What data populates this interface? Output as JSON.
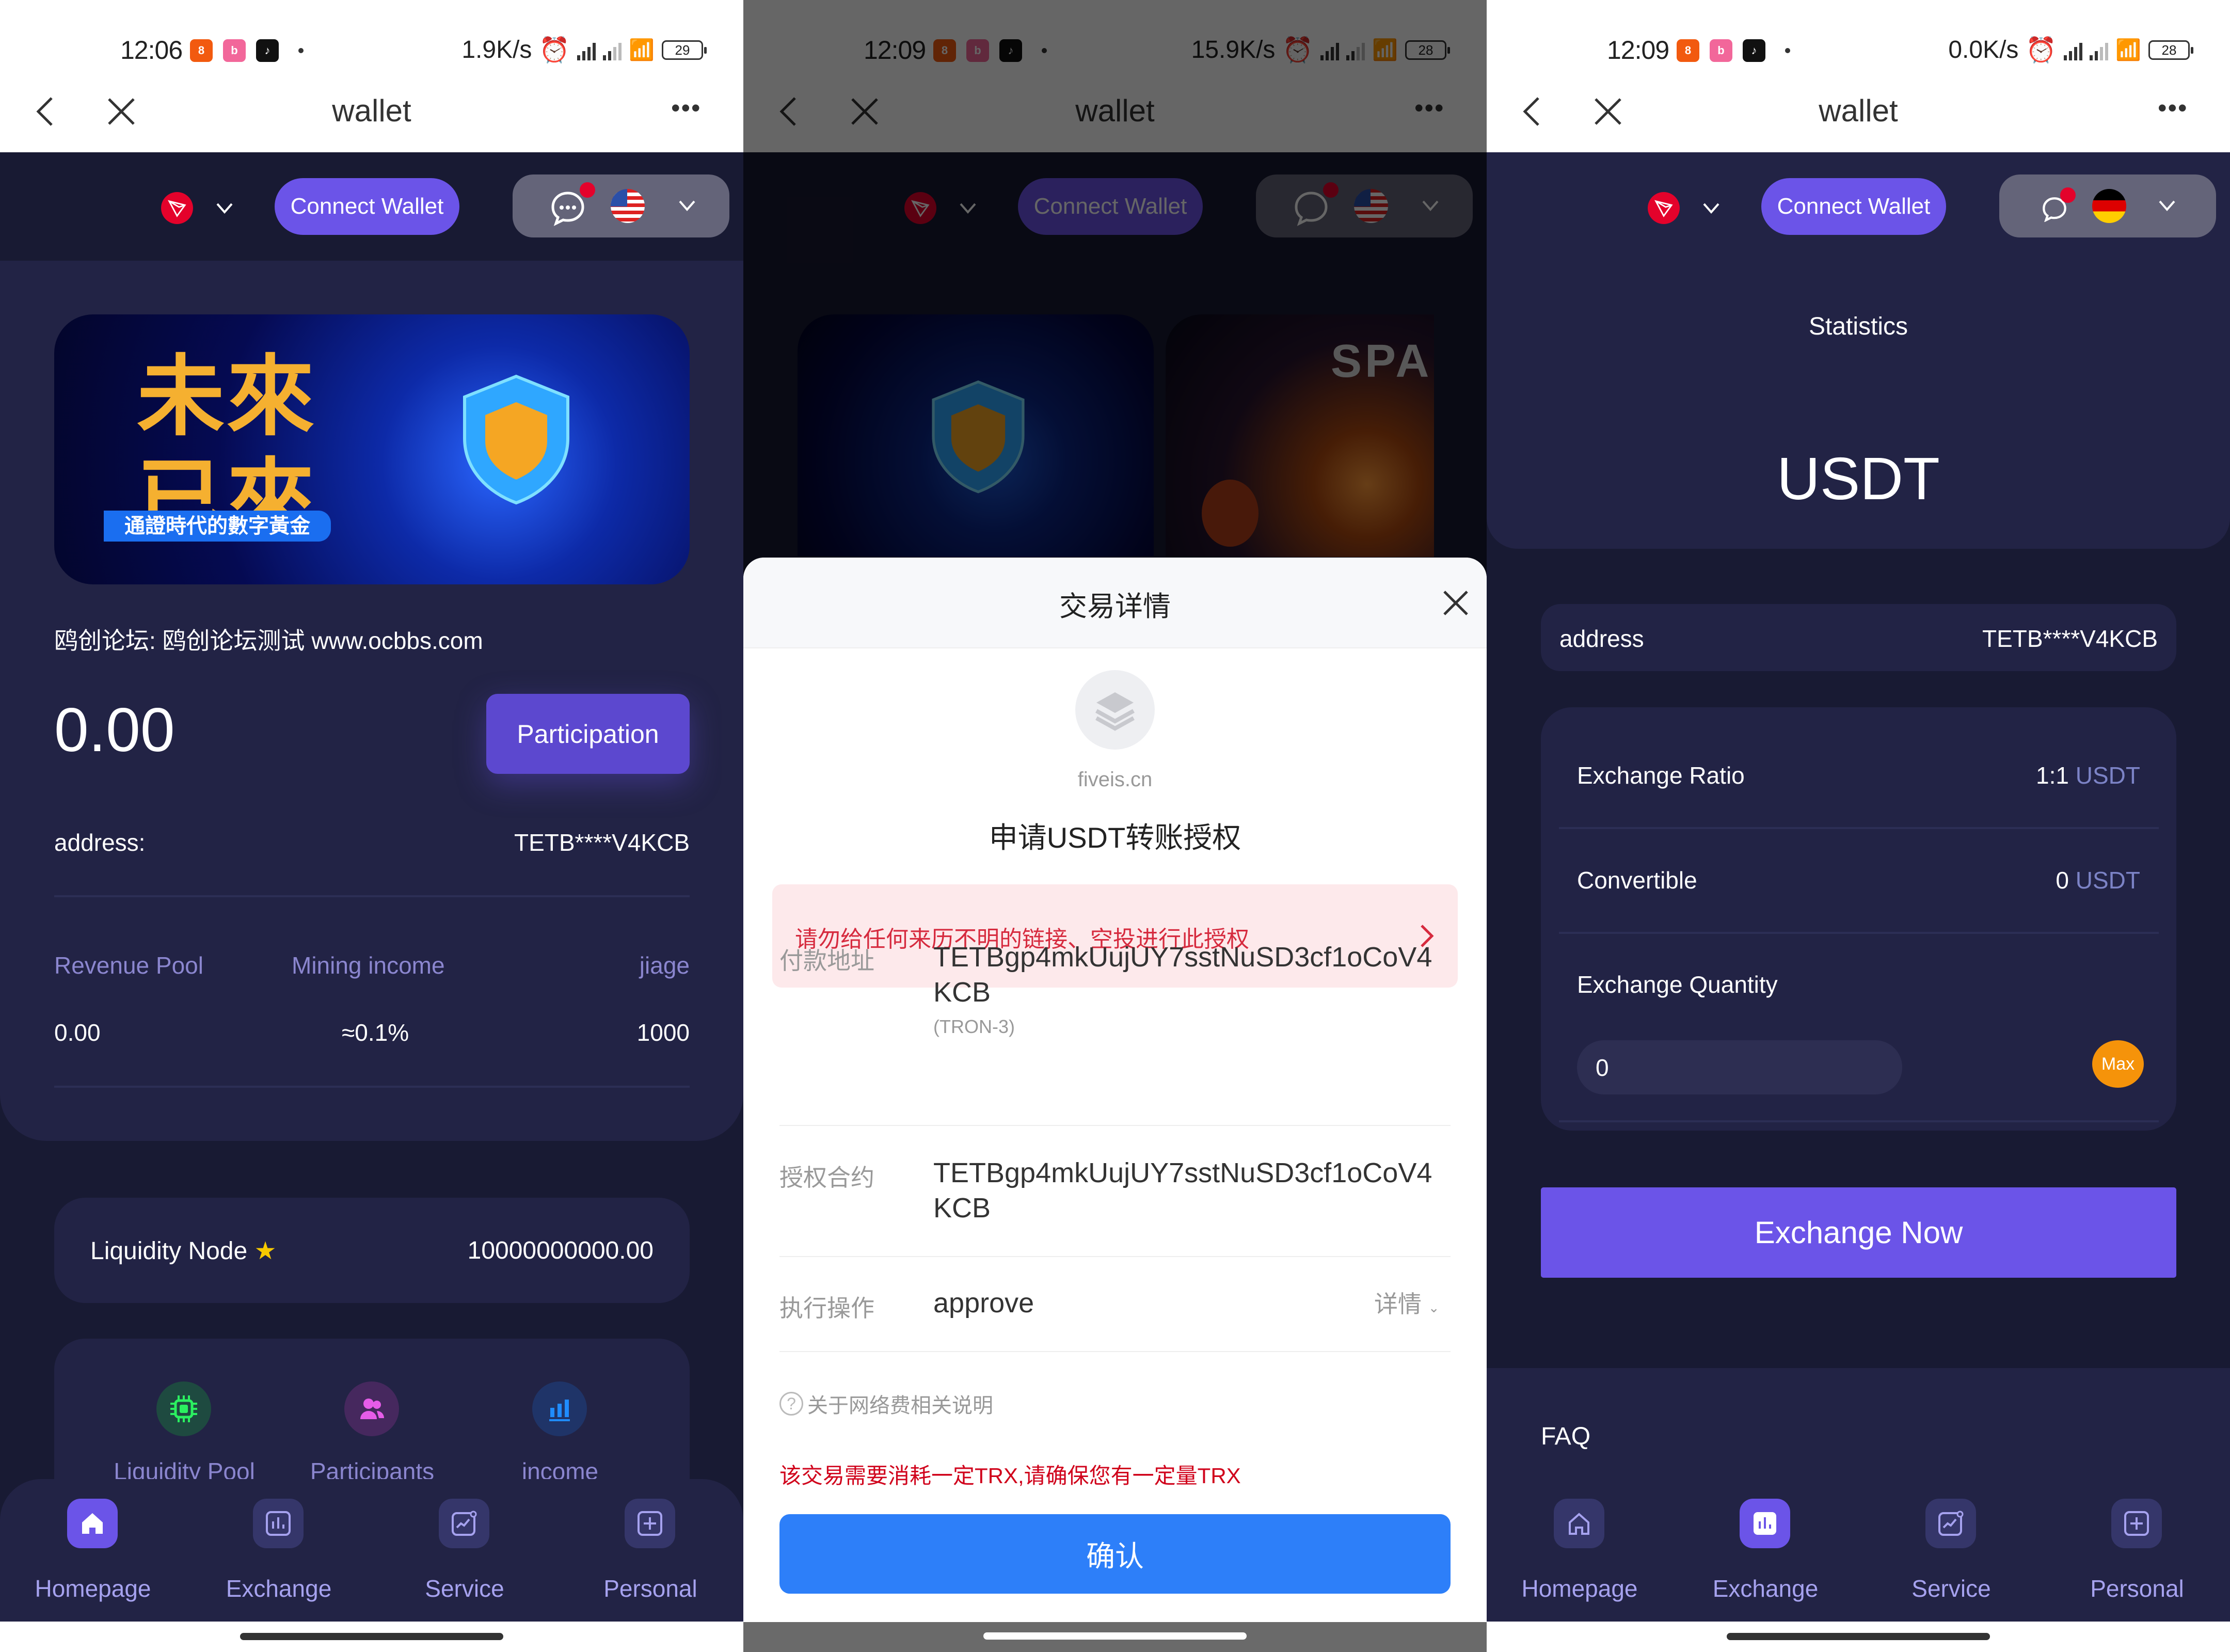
{
  "panels": [
    {
      "status": {
        "time": "12:06",
        "speed": "1.9K/s",
        "battery": "29"
      },
      "header": {
        "title": "wallet",
        "more": "•••"
      },
      "topbar": {
        "connect": "Connect Wallet",
        "language_flag": "us-flag-icon"
      },
      "banner": {
        "title": "未來已來",
        "subtitle": "通證時代的數字黃金"
      },
      "forum_text": "鸥创论坛: 鸥创论坛测试 www.ocbbs.com",
      "balance": "0.00",
      "participation": "Participation",
      "address_label": "address:",
      "address_value": "TETB****V4KCB",
      "stats": {
        "labels": [
          "Revenue Pool",
          "Mining income",
          "jiage"
        ],
        "values": [
          "0.00",
          "≈0.1%",
          "1000"
        ]
      },
      "node": {
        "label": "Liquidity Node",
        "value": "10000000000.00"
      },
      "quick": [
        "Liquidity Pool",
        "Participants",
        "income"
      ],
      "nav": [
        "Homepage",
        "Exchange",
        "Service",
        "Personal"
      ],
      "nav_active": 0
    },
    {
      "status": {
        "time": "12:09",
        "speed": "15.9K/s",
        "battery": "28"
      },
      "header": {
        "title": "wallet",
        "more": "•••"
      },
      "topbar": {
        "connect": "Connect Wallet"
      },
      "banner2_text": "SPAC",
      "sheet": {
        "title": "交易详情",
        "dapp": "fiveis.cn",
        "request": "申请USDT转账授权",
        "warning": "请勿给任何来历不明的链接、空投进行此授权",
        "rows": [
          {
            "label": "付款地址",
            "value": "TETBgp4mkUujUY7sstNuSD3cf1oCoV4KCB",
            "sub": "(TRON-3)"
          },
          {
            "label": "授权合约",
            "value": "TETBgp4mkUujUY7sstNuSD3cf1oCoV4KCB"
          },
          {
            "label": "执行操作",
            "value": "approve",
            "detail": "详情"
          }
        ],
        "fee_note": "关于网络费相关说明",
        "trx_warning": "该交易需要消耗一定TRX,请确保您有一定量TRX",
        "confirm": "确认"
      }
    },
    {
      "status": {
        "time": "12:09",
        "speed": "0.0K/s",
        "battery": "28"
      },
      "header": {
        "title": "wallet",
        "more": "•••"
      },
      "topbar": {
        "connect": "Connect Wallet",
        "language_flag": "de-flag-icon"
      },
      "statistics_label": "Statistics",
      "token": "USDT",
      "address_label": "address",
      "address_value": "TETB****V4KCB",
      "exchange": {
        "ratio_label": "Exchange Ratio",
        "ratio_value": "1:1",
        "ratio_unit": "USDT",
        "convertible_label": "Convertible",
        "convertible_value": "0",
        "convertible_unit": "USDT",
        "quantity_label": "Exchange Quantity",
        "quantity_value": "0",
        "max": "Max",
        "submit": "Exchange Now"
      },
      "faq": "FAQ",
      "nav": [
        "Homepage",
        "Exchange",
        "Service",
        "Personal"
      ],
      "nav_active": 1
    }
  ],
  "colors": {
    "accent": "#6b54e8",
    "confirm_blue": "#2d7ff9",
    "warn_red": "#d0021b",
    "tron_red": "#e4022b",
    "max_orange": "#f5930a"
  }
}
